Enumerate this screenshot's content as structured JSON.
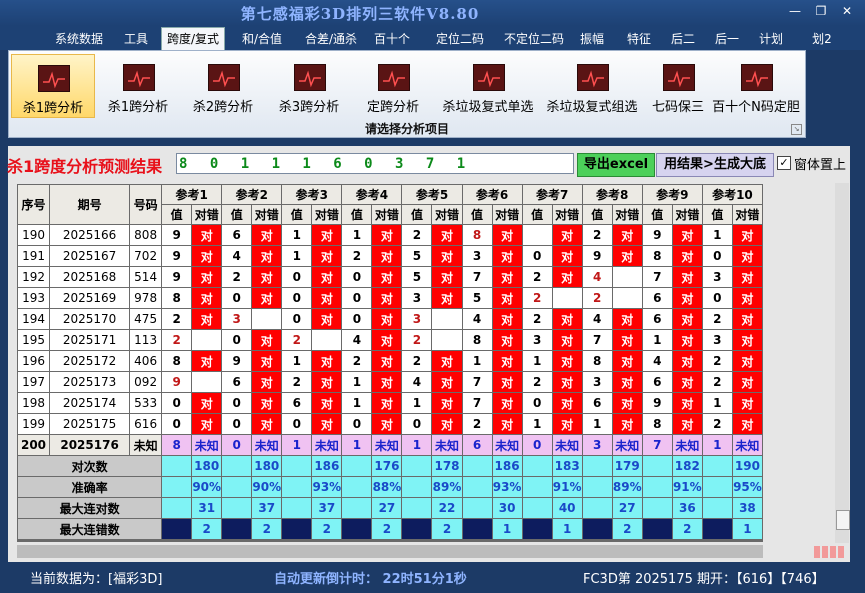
{
  "app": {
    "title": "第七感福彩3D排列三软件V8.80",
    "min_icon": "minimize-icon",
    "max_icon": "restore-icon",
    "close_icon": "close-icon"
  },
  "menu": [
    "系统数据",
    "工具",
    "跨度/复式",
    "和/合值",
    "合差/通杀",
    "百十个",
    "定位二码",
    "不定位二码",
    "振幅",
    "特征",
    "后二",
    "后一",
    "计划",
    "划2"
  ],
  "menu_active": "跨度/复式",
  "ribbon": {
    "tools": [
      "杀1跨分析",
      "杀1跨分析",
      "杀2跨分析",
      "杀3跨分析",
      "定跨分析",
      "杀垃圾复式单选",
      "杀垃圾复式组选",
      "七码保三",
      "百十个N码定胆"
    ],
    "selected": 0,
    "caption": "请选择分析项目",
    "tool_icon": "chart-icon"
  },
  "result": {
    "label": "杀1跨度分析预测结果",
    "value": "8 0 1 1 1 6 0 3 7 1",
    "export_label": "导出excel",
    "gen_label": "用结果>生成大底",
    "pin_label": "窗体置上",
    "pin_checked": true
  },
  "table": {
    "headers": {
      "seq": "序号",
      "period": "期号",
      "code": "号码",
      "refs": [
        "参考1",
        "参考2",
        "参考3",
        "参考4",
        "参考5",
        "参考6",
        "参考7",
        "参考8",
        "参考9",
        "参考10"
      ],
      "val": "值",
      "res": "对错"
    },
    "rows": [
      {
        "seq": "190",
        "period": "2025166",
        "code": "808",
        "vals": [
          "9",
          "6",
          "1",
          "1",
          "2",
          "8",
          "",
          "2",
          "9",
          "1"
        ],
        "hl": [
          0,
          0,
          0,
          0,
          0,
          1,
          0,
          0,
          0,
          0
        ],
        "res": [
          "对",
          "对",
          "对",
          "对",
          "对",
          "对",
          "对",
          "对",
          "对",
          "对"
        ]
      },
      {
        "seq": "191",
        "period": "2025167",
        "code": "702",
        "vals": [
          "9",
          "4",
          "1",
          "2",
          "5",
          "3",
          "0",
          "9",
          "8",
          "0"
        ],
        "hl": [
          0,
          0,
          0,
          0,
          0,
          0,
          0,
          0,
          0,
          0
        ],
        "res": [
          "对",
          "对",
          "对",
          "对",
          "对",
          "对",
          "对",
          "对",
          "对",
          "对"
        ]
      },
      {
        "seq": "192",
        "period": "2025168",
        "code": "514",
        "vals": [
          "9",
          "2",
          "0",
          "0",
          "5",
          "7",
          "2",
          "4",
          "7",
          "3"
        ],
        "hl": [
          0,
          0,
          0,
          0,
          0,
          0,
          0,
          1,
          0,
          0
        ],
        "res": [
          "对",
          "对",
          "对",
          "对",
          "对",
          "对",
          "对",
          "",
          "对",
          "对"
        ]
      },
      {
        "seq": "193",
        "period": "2025169",
        "code": "978",
        "vals": [
          "8",
          "0",
          "0",
          "0",
          "3",
          "5",
          "2",
          "2",
          "6",
          "0"
        ],
        "hl": [
          0,
          0,
          0,
          0,
          0,
          0,
          1,
          1,
          0,
          0
        ],
        "res": [
          "对",
          "对",
          "对",
          "对",
          "对",
          "对",
          "",
          "",
          "对",
          "对"
        ]
      },
      {
        "seq": "194",
        "period": "2025170",
        "code": "475",
        "vals": [
          "2",
          "3",
          "0",
          "0",
          "3",
          "4",
          "2",
          "4",
          "6",
          "2"
        ],
        "hl": [
          0,
          1,
          0,
          0,
          1,
          0,
          0,
          0,
          0,
          0
        ],
        "res": [
          "对",
          "",
          "对",
          "对",
          "",
          "对",
          "对",
          "对",
          "对",
          "对"
        ]
      },
      {
        "seq": "195",
        "period": "2025171",
        "code": "113",
        "vals": [
          "2",
          "0",
          "2",
          "4",
          "2",
          "8",
          "3",
          "7",
          "1",
          "3"
        ],
        "hl": [
          1,
          0,
          1,
          0,
          1,
          0,
          0,
          0,
          0,
          0
        ],
        "res": [
          "",
          "对",
          "",
          "对",
          "",
          "对",
          "对",
          "对",
          "对",
          "对"
        ]
      },
      {
        "seq": "196",
        "period": "2025172",
        "code": "406",
        "vals": [
          "8",
          "9",
          "1",
          "2",
          "2",
          "1",
          "1",
          "8",
          "4",
          "2"
        ],
        "hl": [
          0,
          0,
          0,
          0,
          0,
          0,
          0,
          0,
          0,
          0
        ],
        "res": [
          "对",
          "对",
          "对",
          "对",
          "对",
          "对",
          "对",
          "对",
          "对",
          "对"
        ]
      },
      {
        "seq": "197",
        "period": "2025173",
        "code": "092",
        "vals": [
          "9",
          "6",
          "2",
          "1",
          "4",
          "7",
          "2",
          "3",
          "6",
          "2"
        ],
        "hl": [
          1,
          0,
          0,
          0,
          0,
          0,
          0,
          0,
          0,
          0
        ],
        "res": [
          "",
          "对",
          "对",
          "对",
          "对",
          "对",
          "对",
          "对",
          "对",
          "对"
        ]
      },
      {
        "seq": "198",
        "period": "2025174",
        "code": "533",
        "vals": [
          "0",
          "0",
          "6",
          "1",
          "1",
          "7",
          "0",
          "6",
          "9",
          "1"
        ],
        "hl": [
          0,
          0,
          0,
          0,
          0,
          0,
          0,
          0,
          0,
          0
        ],
        "res": [
          "对",
          "对",
          "对",
          "对",
          "对",
          "对",
          "对",
          "对",
          "对",
          "对"
        ]
      },
      {
        "seq": "199",
        "period": "2025175",
        "code": "616",
        "vals": [
          "0",
          "0",
          "0",
          "0",
          "0",
          "2",
          "1",
          "1",
          "8",
          "2"
        ],
        "hl": [
          0,
          0,
          0,
          0,
          0,
          0,
          0,
          0,
          0,
          0
        ],
        "res": [
          "对",
          "对",
          "对",
          "对",
          "对",
          "对",
          "对",
          "对",
          "对",
          "对"
        ]
      }
    ],
    "last_row": {
      "seq": "200",
      "period": "2025176",
      "code": "未知",
      "vals": [
        "8",
        "0",
        "1",
        "1",
        "1",
        "6",
        "0",
        "3",
        "7",
        "1"
      ],
      "res": [
        "未知",
        "未知",
        "未知",
        "未知",
        "未知",
        "未知",
        "未知",
        "未知",
        "未知",
        "未知"
      ]
    },
    "stats": [
      {
        "label": "对次数",
        "values": [
          "180",
          "180",
          "186",
          "176",
          "178",
          "186",
          "183",
          "179",
          "182",
          "190"
        ]
      },
      {
        "label": "准确率",
        "values": [
          "90%",
          "90%",
          "93%",
          "88%",
          "89%",
          "93%",
          "91%",
          "89%",
          "91%",
          "95%"
        ]
      },
      {
        "label": "最大连对数",
        "values": [
          "31",
          "37",
          "37",
          "27",
          "22",
          "30",
          "40",
          "27",
          "36",
          "38"
        ]
      },
      {
        "label": "最大连错数",
        "values": [
          "2",
          "2",
          "2",
          "2",
          "2",
          "1",
          "1",
          "2",
          "2",
          "1"
        ]
      }
    ]
  },
  "status": {
    "current": "当前数据为：[福彩3D]",
    "countdown": "自动更新倒计时：  22时51分1秒",
    "draw": "FC3D第 2025175 期开：【616】【746】"
  }
}
